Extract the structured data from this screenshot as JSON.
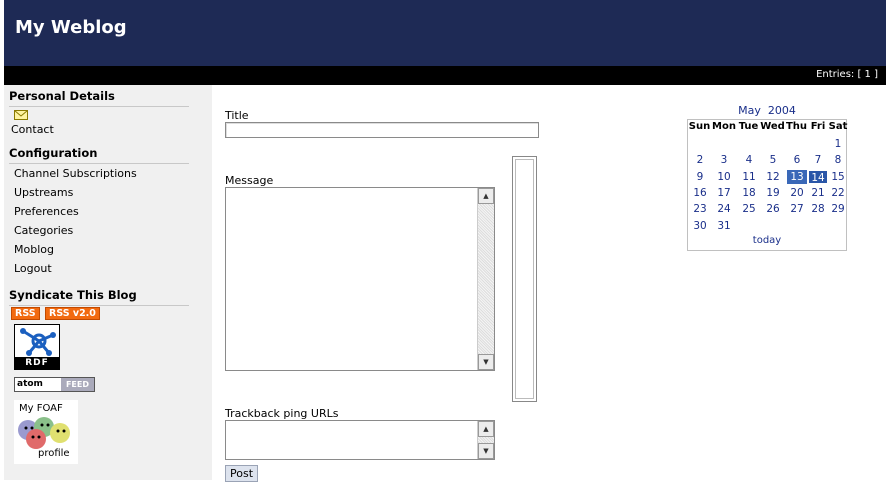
{
  "header": {
    "title": "My Weblog"
  },
  "bar": {
    "entries": "Entries: [ 1 ]"
  },
  "sidebar": {
    "personal": {
      "title": "Personal Details",
      "contact": "Contact"
    },
    "config": {
      "title": "Configuration",
      "items": [
        "Channel Subscriptions",
        "Upstreams",
        "Preferences",
        "Categories",
        "Moblog",
        "Logout"
      ]
    },
    "syndicate": {
      "title": "Syndicate This Blog",
      "rss": "RSS",
      "rss2": "RSS v2.0",
      "rdf": "RDF",
      "atom": "atom",
      "feed": "FEED",
      "foaf_my": "My FOAF",
      "foaf_profile": "profile"
    }
  },
  "form": {
    "title_label": "Title",
    "title_value": "",
    "message_label": "Message",
    "message_value": "",
    "trackback_label": "Trackback ping URLs",
    "trackback_value": "",
    "post_button": "Post"
  },
  "calendar": {
    "month": "May",
    "year": "2004",
    "day_headers": [
      "Sun",
      "Mon",
      "Tue",
      "Wed",
      "Thu",
      "Fri",
      "Sat"
    ],
    "weeks": [
      [
        "",
        "",
        "",
        "",
        "",
        "",
        "1"
      ],
      [
        "2",
        "3",
        "4",
        "5",
        "6",
        "7",
        "8"
      ],
      [
        "9",
        "10",
        "11",
        "12",
        "13",
        "14",
        "15"
      ],
      [
        "16",
        "17",
        "18",
        "19",
        "20",
        "21",
        "22"
      ],
      [
        "23",
        "24",
        "25",
        "26",
        "27",
        "28",
        "29"
      ],
      [
        "30",
        "31",
        "",
        "",
        "",
        "",
        ""
      ]
    ],
    "highlighted": [
      "13",
      "14"
    ],
    "today_link": "today"
  },
  "colors": {
    "header_bg": "#1e2a55",
    "link": "#1a2f8a",
    "rss_orange": "#f26a10",
    "highlight": "#3a68b8"
  }
}
